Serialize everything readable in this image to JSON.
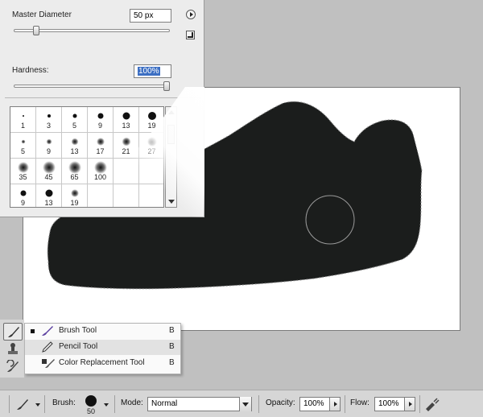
{
  "brush_picker": {
    "master_diameter_label": "Master Diameter",
    "master_diameter_value": "50 px",
    "hardness_label": "Hardness:",
    "hardness_value": "100%",
    "diameter_slider_level": 0.13,
    "hardness_slider_level": 1.0,
    "presets": [
      {
        "size": "1",
        "soft": false
      },
      {
        "size": "3",
        "soft": false
      },
      {
        "size": "5",
        "soft": false
      },
      {
        "size": "9",
        "soft": false
      },
      {
        "size": "13",
        "soft": false
      },
      {
        "size": "19",
        "soft": false
      },
      {
        "size": "5",
        "soft": true
      },
      {
        "size": "9",
        "soft": true
      },
      {
        "size": "13",
        "soft": true
      },
      {
        "size": "17",
        "soft": true
      },
      {
        "size": "21",
        "soft": true
      },
      {
        "size": "27",
        "soft": true
      },
      {
        "size": "35",
        "soft": true
      },
      {
        "size": "45",
        "soft": true
      },
      {
        "size": "65",
        "soft": true
      },
      {
        "size": "100",
        "soft": true
      },
      {
        "size": "",
        "soft": true
      },
      {
        "size": "",
        "soft": true
      },
      {
        "size": "9",
        "soft": false
      },
      {
        "size": "13",
        "soft": false
      },
      {
        "size": "19",
        "soft": true
      },
      {
        "size": "",
        "soft": false
      },
      {
        "size": "",
        "soft": false
      },
      {
        "size": "",
        "soft": false
      }
    ]
  },
  "tool_menu": {
    "items": [
      {
        "label": "Brush Tool",
        "key": "B",
        "selected": true,
        "icon": "brush-icon"
      },
      {
        "label": "Pencil Tool",
        "key": "B",
        "selected": false,
        "icon": "pencil-icon"
      },
      {
        "label": "Color Replacement Tool",
        "key": "B",
        "selected": false,
        "icon": "color-replacement-icon"
      }
    ]
  },
  "options_bar": {
    "brush_label": "Brush:",
    "brush_size": "50",
    "mode_label": "Mode:",
    "mode_value": "Normal",
    "opacity_label": "Opacity:",
    "opacity_value": "100%",
    "flow_label": "Flow:",
    "flow_value": "100%"
  },
  "colors": {
    "shoe_fill": "#1b1d1c",
    "selection": "#3c6fc3",
    "panel": "#ececec"
  }
}
